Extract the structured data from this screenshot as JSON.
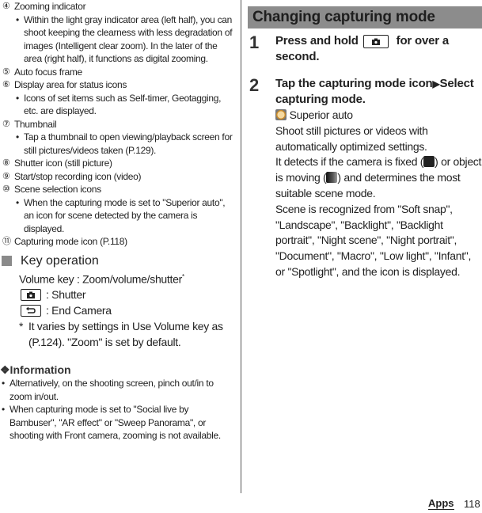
{
  "left": {
    "items": [
      {
        "num": "④",
        "label": "Zooming indicator",
        "bullets": [
          "Within the light gray indicator area (left half), you can shoot keeping the clearness with less degradation of images (Intelligent clear zoom). In the later of the area (right half), it functions as digital zooming."
        ]
      },
      {
        "num": "⑤",
        "label": "Auto focus frame",
        "bullets": []
      },
      {
        "num": "⑥",
        "label": "Display area for status icons",
        "bullets": [
          "Icons of set items such as Self-timer, Geotagging, etc. are displayed."
        ]
      },
      {
        "num": "⑦",
        "label": "Thumbnail",
        "bullets": [
          "Tap a thumbnail to open viewing/playback screen for still pictures/videos taken (P.129)."
        ]
      },
      {
        "num": "⑧",
        "label": "Shutter icon (still picture)",
        "bullets": []
      },
      {
        "num": "⑨",
        "label": "Start/stop recording icon (video)",
        "bullets": []
      },
      {
        "num": "⑩",
        "label": "Scene selection icons",
        "bullets": [
          "When the capturing mode is set to \"Superior auto\", an icon for scene detected by the camera is displayed."
        ]
      },
      {
        "num": "⑪",
        "label": "Capturing mode icon (P.118)",
        "bullets": []
      }
    ],
    "key_operation": {
      "title": "Key operation",
      "volume_line": "Volume key : Zoom/volume/shutter",
      "volume_mark": "*",
      "keys": [
        {
          "icon": "camera-key-icon",
          "glyph": "▲",
          "label": ": Shutter"
        },
        {
          "icon": "back-key-icon",
          "glyph": "↶",
          "label": ": End Camera"
        }
      ],
      "note_mark": "*",
      "note": "It varies by settings in Use Volume key as (P.124). \"Zoom\" is set by default."
    },
    "information": {
      "title": "❖Information",
      "bullets": [
        "Alternatively, on the shooting screen, pinch out/in to zoom in/out.",
        "When capturing mode is set to \"Social live by Bambuser\", \"AR effect\" or \"Sweep Panorama\", or shooting with Front camera, zooming is not available."
      ]
    }
  },
  "right": {
    "section_title": "Changing capturing mode",
    "step1": {
      "num": "1",
      "text_a": "Press and hold",
      "text_b": "for over a second."
    },
    "step2": {
      "num": "2",
      "text_a": "Tap the capturing mode icon",
      "arrow": "▶",
      "text_b": "Select capturing mode.",
      "mode_label": "Superior auto",
      "desc1": "Shoot still pictures or videos with automatically optimized settings.",
      "desc2_a": "It detects if the camera is fixed (",
      "desc2_b": ") or object is moving (",
      "desc2_c": ") and determines the most suitable scene mode.",
      "desc3": "Scene is recognized from \"Soft snap\", \"Landscape\", \"Backlight\", \"Backlight portrait\", \"Night scene\", \"Night portrait\", \"Document\", \"Macro\", \"Low light\", \"Infant\", or \"Spotlight\", and the icon is displayed."
    }
  },
  "footer": {
    "section": "Apps",
    "page": "118"
  }
}
